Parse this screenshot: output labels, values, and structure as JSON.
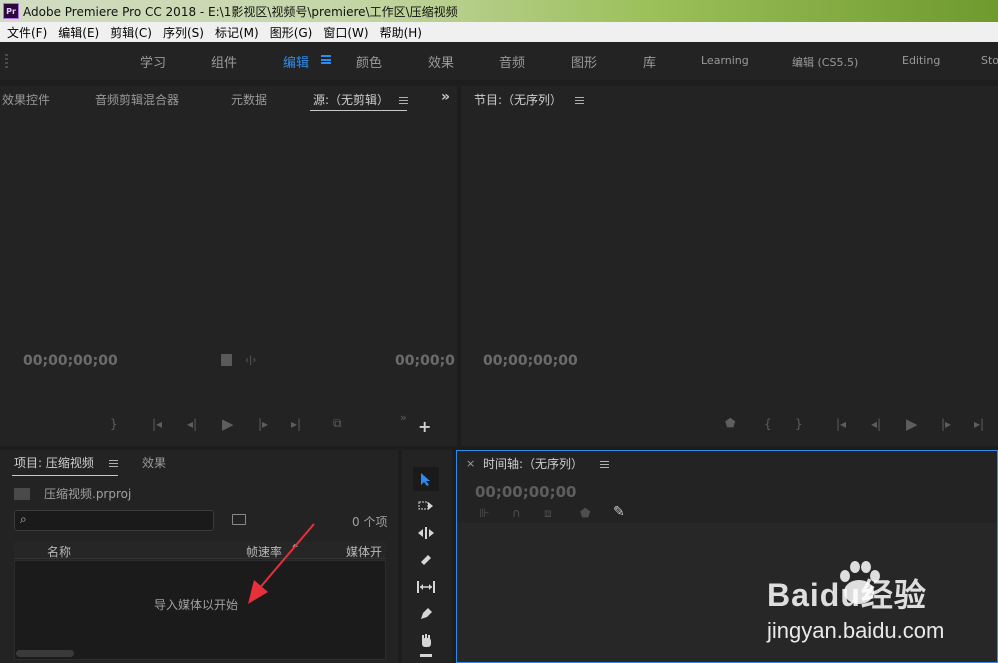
{
  "window": {
    "app_icon_text": "Pr",
    "title": "Adobe Premiere Pro CC 2018 - E:\\1影视区\\视频号\\premiere\\工作区\\压缩视频"
  },
  "menu": [
    "文件(F)",
    "编辑(E)",
    "剪辑(C)",
    "序列(S)",
    "标记(M)",
    "图形(G)",
    "窗口(W)",
    "帮助(H)"
  ],
  "workspaces": [
    "学习",
    "组件",
    "编辑",
    "颜色",
    "效果",
    "音频",
    "图形",
    "库",
    "Learning",
    "编辑 (CS5.5)",
    "Editing",
    "Sto"
  ],
  "active_workspace": "编辑",
  "source_panel": {
    "tabs": [
      "效果控件",
      "音频剪辑混合器",
      "元数据",
      "源:（无剪辑）"
    ],
    "timecode_left": "00;00;00;00",
    "timecode_right": "00;00;0"
  },
  "program_panel": {
    "title": "节目:（无序列）",
    "timecode": "00;00;00;00"
  },
  "project_panel": {
    "tabs": [
      "项目: 压缩视频",
      "效果"
    ],
    "file_name": "压缩视频.prproj",
    "search_placeholder": "",
    "item_count": "0 个项",
    "columns": [
      "名称",
      "帧速率",
      "媒体开"
    ],
    "empty_message": "导入媒体以开始"
  },
  "timeline_panel": {
    "title": "时间轴:（无序列）",
    "timecode": "00;00;00;00"
  },
  "watermark": {
    "brand": "Baidu经验",
    "url": "jingyan.baidu.com"
  },
  "colors": {
    "accent": "#2d8ceb",
    "panel_bg": "#232323",
    "arrow": "#e8303a"
  },
  "tools": [
    "selection-tool-icon",
    "track-select-tool-icon",
    "ripple-edit-tool-icon",
    "razor-tool-icon",
    "slip-tool-icon",
    "pen-tool-icon",
    "hand-tool-icon",
    "type-tool-icon"
  ]
}
